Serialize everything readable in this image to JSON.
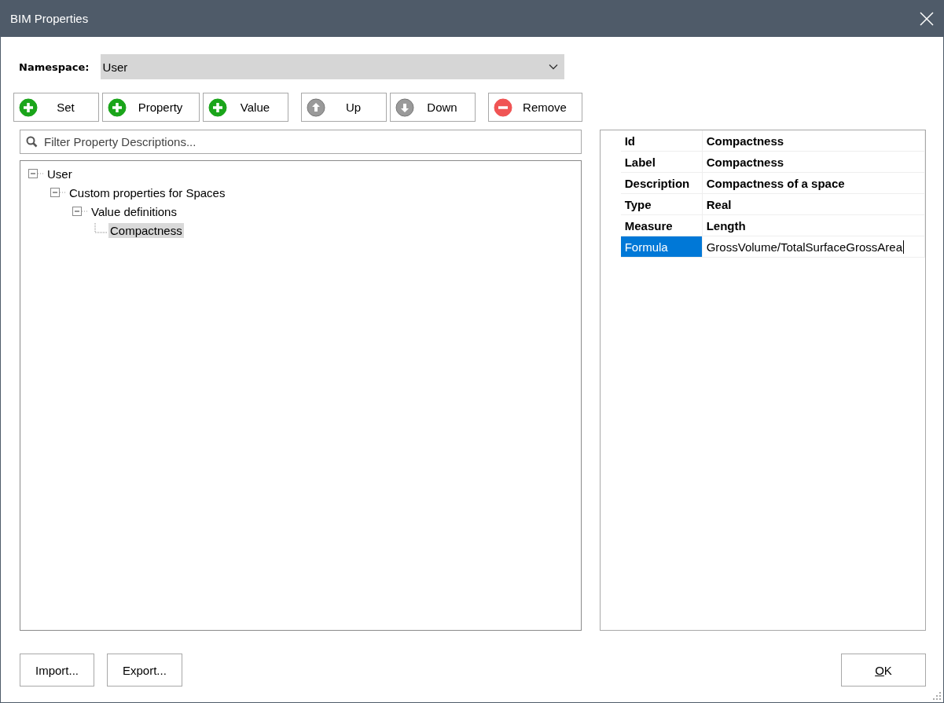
{
  "window": {
    "title": "BIM Properties"
  },
  "namespace": {
    "label": "Namespace:",
    "value": "User"
  },
  "toolbar": [
    {
      "label": "Set",
      "kind": "add"
    },
    {
      "label": "Property",
      "kind": "add"
    },
    {
      "label": "Value",
      "kind": "add"
    },
    {
      "label": "Up",
      "kind": "up"
    },
    {
      "label": "Down",
      "kind": "down"
    },
    {
      "label": "Remove",
      "kind": "remove"
    }
  ],
  "filter": {
    "placeholder": "Filter Property Descriptions..."
  },
  "tree": [
    {
      "label": "User",
      "expanded": true,
      "selected": false,
      "children": [
        {
          "label": "Custom properties for Spaces",
          "expanded": true,
          "selected": false,
          "children": [
            {
              "label": "Value definitions",
              "expanded": true,
              "selected": false,
              "children": [
                {
                  "label": "Compactness",
                  "selected": true
                }
              ]
            }
          ]
        }
      ]
    }
  ],
  "properties": [
    {
      "key": "Id",
      "value": "Compactness",
      "selected": false
    },
    {
      "key": "Label",
      "value": "Compactness",
      "selected": false
    },
    {
      "key": "Description",
      "value": "Compactness of a space",
      "selected": false
    },
    {
      "key": "Type",
      "value": "Real",
      "selected": false
    },
    {
      "key": "Measure",
      "value": "Length",
      "selected": false
    },
    {
      "key": "Formula",
      "value": "GrossVolume/TotalSurfaceGrossArea",
      "selected": true
    }
  ],
  "footer_buttons": [
    {
      "label": "Import..."
    },
    {
      "label": "Export..."
    }
  ],
  "ok_button": {
    "label": "OK",
    "mnemonic_underlined": true
  }
}
